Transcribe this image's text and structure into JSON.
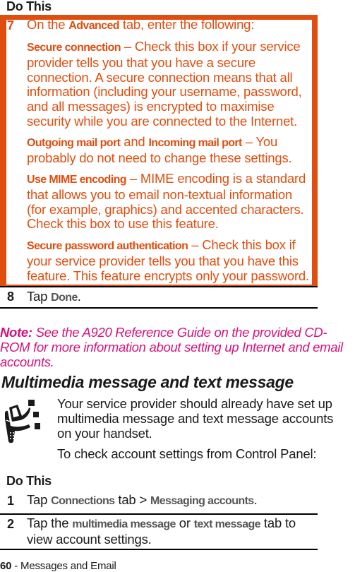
{
  "table1": {
    "header": "Do This",
    "step7": {
      "number": "7",
      "intro_prefix": "On the ",
      "intro_keyword": "Advanced",
      "intro_suffix": " tab, enter the following:",
      "items": [
        {
          "keyword": "Secure connection",
          "text": " – Check this box if your service provider tells you that you have a secure connection. A secure connection means that all information (including your username, password, and all messages) is encrypted to maximise security while you are connected to the Internet."
        },
        {
          "keyword": "Outgoing mail port",
          "joiner": " and ",
          "keyword2": "Incoming mail port",
          "text": " – You probably do not need to change these settings."
        },
        {
          "keyword": "Use MIME encoding",
          "text": " – MIME encoding is a standard that allows you to email non-textual information (for example, graphics) and accented characters. Check this box to use this feature."
        },
        {
          "keyword": "Secure password authentication",
          "text": " – Check this box if your service provider tells you that you have this feature. This feature encrypts only your password."
        }
      ]
    },
    "step8": {
      "number": "8",
      "prefix": "Tap ",
      "keyword": "Done",
      "suffix": "."
    }
  },
  "note": {
    "label": "Note:",
    "text": " See the A920 Reference Guide on the provided CD-ROM for more information about setting up Internet and email accounts."
  },
  "section": {
    "title": "Multimedia message and text message",
    "icon": "phone-messaging-icon",
    "para1": "Your service provider should already have set up multimedia message and text message accounts on your handset.",
    "para2": "To check account settings from Control Panel:"
  },
  "table2": {
    "header": "Do This",
    "step1": {
      "number": "1",
      "prefix": "Tap ",
      "keyword1": "Connections",
      "middle": " tab > ",
      "keyword2": "Messaging accounts",
      "suffix": "."
    },
    "step2": {
      "number": "2",
      "prefix": "Tap the ",
      "keyword1": "multimedia message",
      "middle": " or ",
      "keyword2": "text message",
      "suffix": " tab to view account settings."
    }
  },
  "footer": {
    "page": "60",
    "text": " - Messages and Email"
  },
  "colors": {
    "accent_orange": "#e04e0f",
    "note_magenta": "#d6127a"
  }
}
